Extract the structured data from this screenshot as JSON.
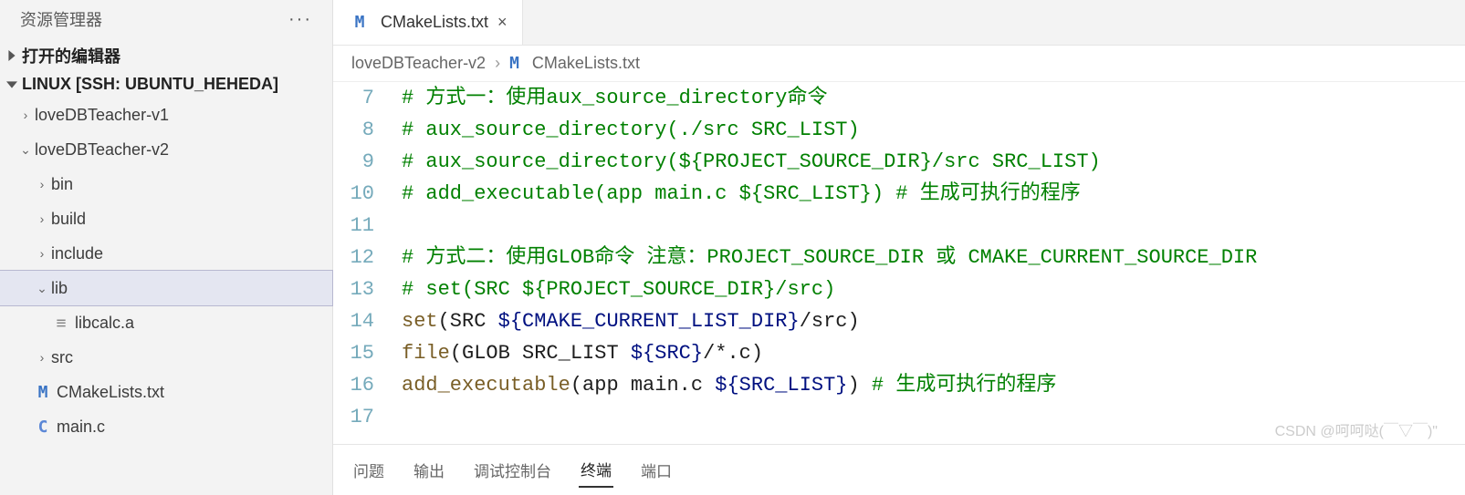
{
  "sidebar": {
    "title": "资源管理器",
    "sections": {
      "open_editors": "打开的编辑器",
      "workspace": "LINUX [SSH: UBUNTU_HEHEDA]"
    },
    "tree": {
      "v1": "loveDBTeacher-v1",
      "v2": "loveDBTeacher-v2",
      "bin": "bin",
      "build": "build",
      "include": "include",
      "lib": "lib",
      "libcalc": "libcalc.a",
      "src": "src",
      "cmake": "CMakeLists.txt",
      "mainc": "main.c"
    }
  },
  "tabs": {
    "active": "CMakeLists.txt"
  },
  "breadcrumb": {
    "root": "loveDBTeacher-v2",
    "file": "CMakeLists.txt"
  },
  "editor": {
    "lines": [
      {
        "n": "7",
        "html": "<span class='tok-comment'># 方式一：使用aux_source_directory命令</span>"
      },
      {
        "n": "8",
        "html": "<span class='tok-comment'># aux_source_directory(./src SRC_LIST)</span>"
      },
      {
        "n": "9",
        "html": "<span class='tok-comment'># aux_source_directory(${PROJECT_SOURCE_DIR}/src SRC_LIST)</span>"
      },
      {
        "n": "10",
        "html": "<span class='tok-comment'># add_executable(app main.c ${SRC_LIST}) # 生成可执行的程序</span>"
      },
      {
        "n": "11",
        "html": ""
      },
      {
        "n": "12",
        "html": "<span class='tok-comment'># 方式二：使用GLOB命令 注意：PROJECT_SOURCE_DIR 或 CMAKE_CURRENT_SOURCE_DIR</span>"
      },
      {
        "n": "13",
        "html": "<span class='tok-comment'># set(SRC ${PROJECT_SOURCE_DIR}/src)</span>"
      },
      {
        "n": "14",
        "html": "<span class='tok-fn'>set</span><span class='tok-punc'>(SRC </span><span class='tok-var'>${CMAKE_CURRENT_LIST_DIR}</span><span class='tok-punc'>/src)</span>"
      },
      {
        "n": "15",
        "html": "<span class='tok-fn'>file</span><span class='tok-punc'>(GLOB SRC_LIST </span><span class='tok-var'>${SRC}</span><span class='tok-punc'>/*.c)</span>"
      },
      {
        "n": "16",
        "html": "<span class='tok-fn'>add_executable</span><span class='tok-punc'>(app main.c </span><span class='tok-var'>${SRC_LIST}</span><span class='tok-punc'>)</span> <span class='tok-comment'># 生成可执行的程序</span>"
      },
      {
        "n": "17",
        "html": ""
      }
    ]
  },
  "panel": {
    "tabs": {
      "problems": "问题",
      "output": "输出",
      "debug": "调试控制台",
      "terminal": "终端",
      "ports": "端口"
    }
  },
  "watermark": "CSDN @呵呵哒(￣▽￣)\""
}
